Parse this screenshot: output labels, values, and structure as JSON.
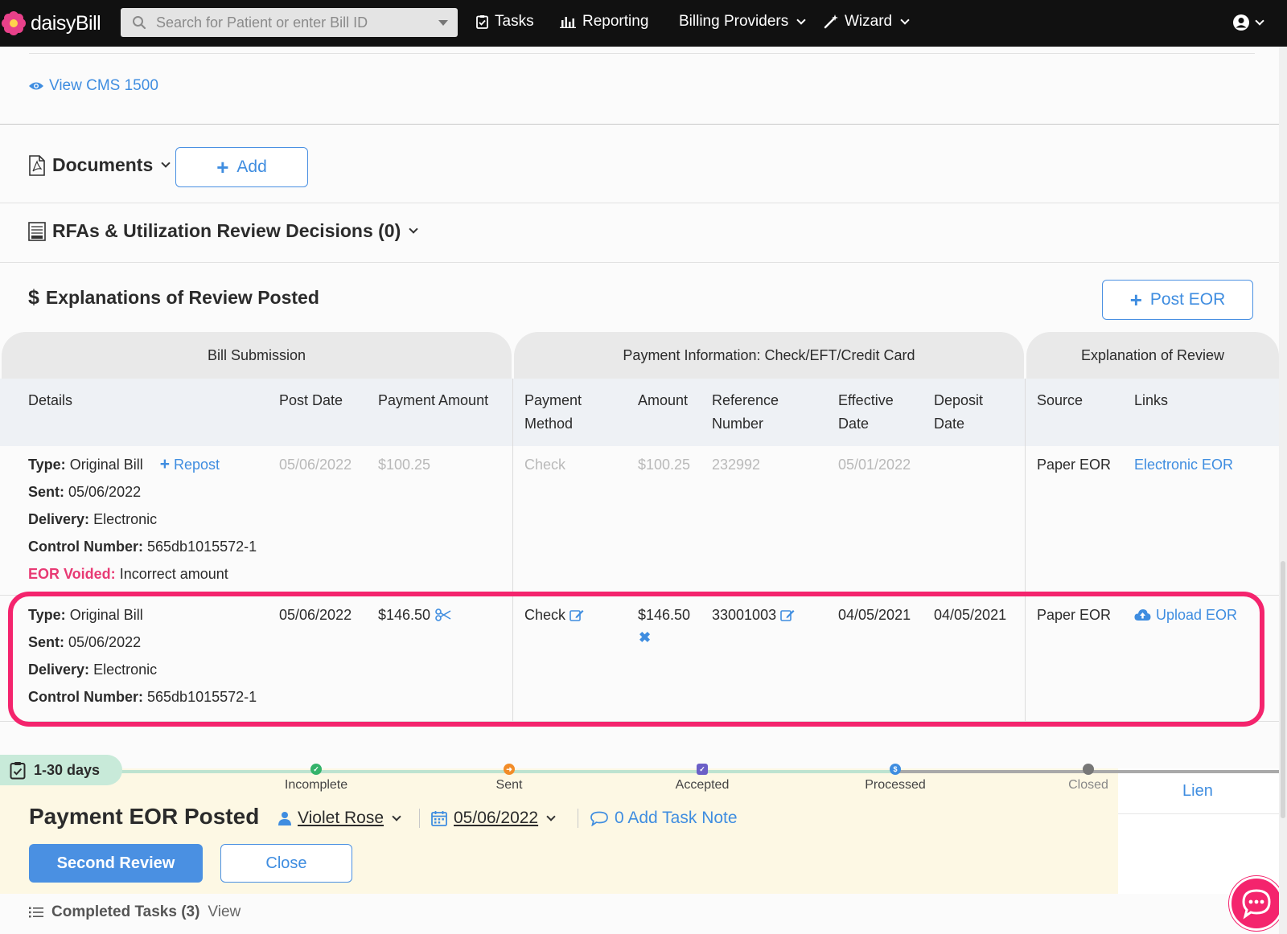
{
  "nav": {
    "brand": "daisyBill",
    "search_placeholder": "Search for Patient or enter Bill ID",
    "tasks": "Tasks",
    "reporting": "Reporting",
    "billing_providers": "Billing Providers",
    "wizard": "Wizard"
  },
  "bill": {
    "view_cms": "View CMS 1500",
    "documents": "Documents",
    "add_label": "Add",
    "rfas": "RFAs & Utilization Review Decisions (0)",
    "eor_title": "Explanations of Review Posted",
    "post_eor": "Post EOR"
  },
  "table": {
    "groups": {
      "bill_submission": "Bill Submission",
      "payment_info": "Payment Information: Check/EFT/Credit Card",
      "explanation": "Explanation of Review"
    },
    "columns": {
      "details": "Details",
      "post_date": "Post Date",
      "payment_amount": "Payment Amount",
      "payment_method_1": "Payment",
      "payment_method_2": "Method",
      "amount": "Amount",
      "reference_1": "Reference",
      "reference_2": "Number",
      "effective_1": "Effective",
      "effective_2": "Date",
      "deposit_1": "Deposit",
      "deposit_2": "Date",
      "source": "Source",
      "links": "Links"
    },
    "labels": {
      "type": "Type:",
      "sent": "Sent:",
      "delivery": "Delivery:",
      "control": "Control Number:",
      "voided": "EOR Voided:"
    },
    "rows": [
      {
        "type": "Original Bill",
        "repost": "Repost",
        "sent": "05/06/2022",
        "delivery": "Electronic",
        "control": "565db1015572-1",
        "voided_reason": "Incorrect amount",
        "post_date": "05/06/2022",
        "payment_amount": "$100.25",
        "method": "Check",
        "amount": "$100.25",
        "reference": "232992",
        "effective": "05/01/2022",
        "deposit": "",
        "source": "Paper EOR",
        "link": "Electronic EOR"
      },
      {
        "type": "Original Bill",
        "sent": "05/06/2022",
        "delivery": "Electronic",
        "control": "565db1015572-1",
        "post_date": "05/06/2022",
        "payment_amount": "$146.50",
        "method": "Check",
        "amount": "$146.50",
        "reference": "33001003",
        "effective": "04/05/2021",
        "deposit": "04/05/2021",
        "source": "Paper EOR",
        "link": "Upload EOR"
      }
    ]
  },
  "workflow": {
    "days": "1-30 days",
    "stages": [
      "Incomplete",
      "Sent",
      "Accepted",
      "Processed",
      "Closed"
    ],
    "lien": "Lien",
    "status": "Payment EOR Posted",
    "assignee": "Violet Rose",
    "date": "05/06/2022",
    "task_note": "0 Add Task Note",
    "second_review": "Second Review",
    "close": "Close",
    "completed_label": "Completed Tasks (3)",
    "completed_view": "View"
  },
  "colors": {
    "accent": "#4a90e2",
    "highlight": "#f4246d",
    "voided": "#e83a74",
    "nav_bg": "#111111"
  }
}
